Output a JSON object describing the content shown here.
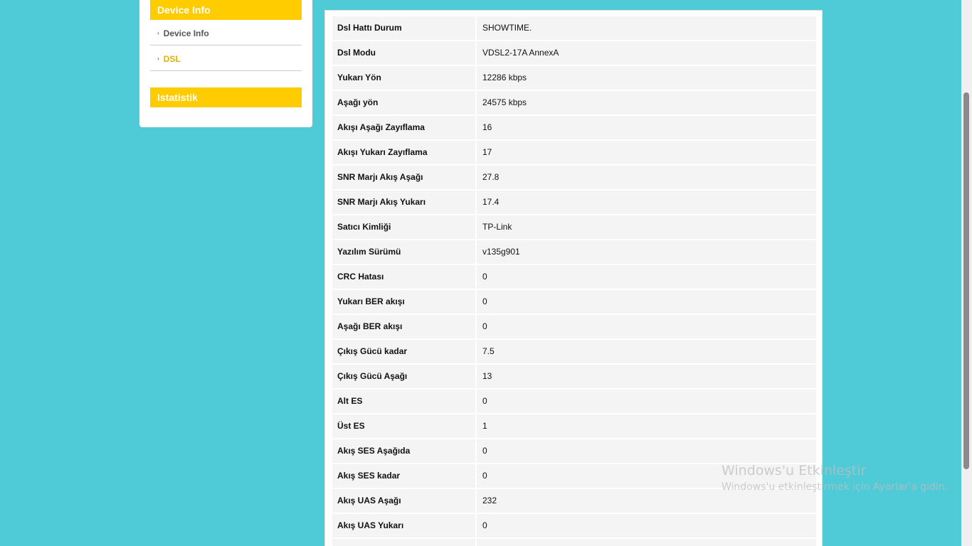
{
  "sidebar": {
    "device_info_header": "Device Info",
    "items": [
      {
        "label": "Device Info",
        "bullet": "›"
      },
      {
        "label": "DSL",
        "bullet": "›"
      }
    ],
    "statistics_header": "Istatistik"
  },
  "dsl_table": [
    {
      "label": "Dsl Hattı Durum",
      "value": "SHOWTIME."
    },
    {
      "label": "Dsl Modu",
      "value": "VDSL2-17A AnnexA"
    },
    {
      "label": "Yukarı Yön",
      "value": "12286 kbps"
    },
    {
      "label": "Aşağı yön",
      "value": "24575 kbps"
    },
    {
      "label": "Akışı Aşağı Zayıflama",
      "value": "16"
    },
    {
      "label": "Akışı Yukarı Zayıflama",
      "value": "17"
    },
    {
      "label": "SNR Marjı Akış Aşağı",
      "value": "27.8"
    },
    {
      "label": "SNR Marjı Akış Yukarı",
      "value": "17.4"
    },
    {
      "label": "Satıcı Kimliği",
      "value": "TP-Link"
    },
    {
      "label": "Yazılım Sürümü",
      "value": "v135g901"
    },
    {
      "label": "CRC Hatası",
      "value": "0"
    },
    {
      "label": "Yukarı BER akışı",
      "value": "0"
    },
    {
      "label": "Aşağı BER akışı",
      "value": "0"
    },
    {
      "label": "Çıkış Gücü kadar",
      "value": "7.5"
    },
    {
      "label": "Çıkış Gücü Aşağı",
      "value": "13"
    },
    {
      "label": "Alt ES",
      "value": "0"
    },
    {
      "label": "Üst ES",
      "value": "1"
    },
    {
      "label": "Akış SES Aşağıda",
      "value": "0"
    },
    {
      "label": "Akış SES kadar",
      "value": "0"
    },
    {
      "label": "Akış UAS Aşağı",
      "value": "232"
    },
    {
      "label": "Akış UAS Yukarı",
      "value": "0"
    }
  ],
  "watermark": {
    "title": "Windows'u Etkinleştir",
    "subtitle": "Windows'u etkinleştirmek için Ayarlar'a gidin."
  },
  "colors": {
    "background": "#4ecbd6",
    "accent": "#ffcc00",
    "active_link": "#e0b100"
  }
}
